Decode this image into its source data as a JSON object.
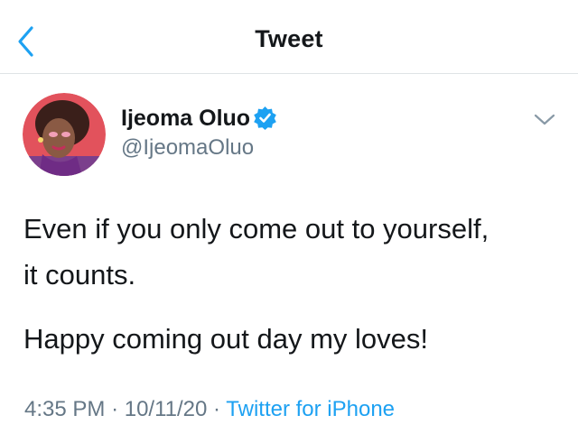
{
  "header": {
    "title": "Tweet",
    "back_icon": "chevron-left-icon"
  },
  "tweet": {
    "author": {
      "name": "Ijeoma Oluo",
      "handle": "@IjeomaOluo",
      "verified": true,
      "verified_icon": "verified-badge-icon"
    },
    "menu_icon": "chevron-down-icon",
    "text_lines": [
      "Even if you only come out to yourself,",
      "it counts."
    ],
    "text_paragraph2": "Happy coming out day my loves!",
    "time": "4:35 PM",
    "separator": "·",
    "date": "10/11/20",
    "source": "Twitter for iPhone"
  },
  "colors": {
    "accent": "#1da1f2",
    "text": "#14171a",
    "muted": "#657786",
    "divider": "#dfe3e6"
  }
}
